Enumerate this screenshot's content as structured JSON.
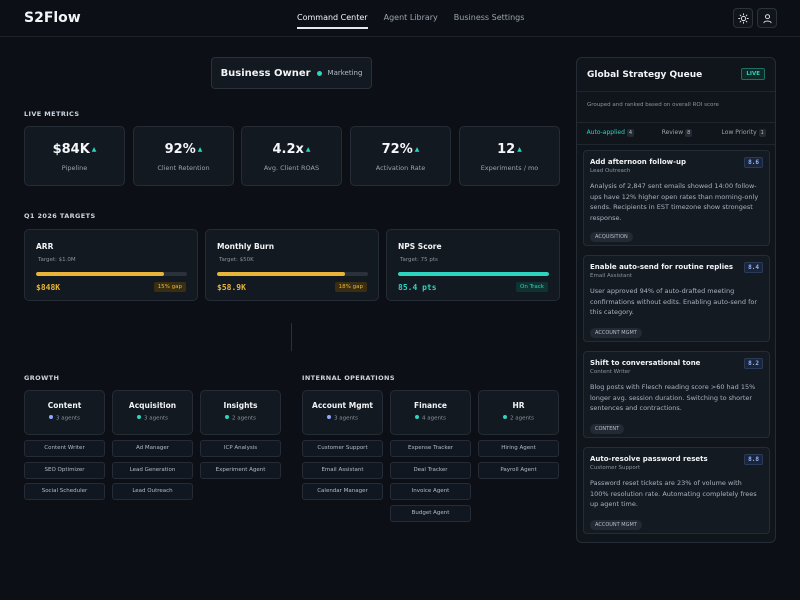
{
  "app": {
    "logo": "S2Flow"
  },
  "nav": {
    "items": [
      "Command Center",
      "Agent Library",
      "Business Settings"
    ]
  },
  "owner": {
    "title": "Business Owner",
    "subtitle": "Marketing"
  },
  "sections": {
    "live_metrics": "LIVE METRICS",
    "targets": "Q1 2026 TARGETS",
    "growth": "GROWTH",
    "internal_ops": "INTERNAL OPERATIONS"
  },
  "metrics": [
    {
      "value": "$84K",
      "label": "Pipeline"
    },
    {
      "value": "92%",
      "label": "Client Retention"
    },
    {
      "value": "4.2x",
      "label": "Avg. Client ROAS"
    },
    {
      "value": "72%",
      "label": "Activation Rate"
    },
    {
      "value": "12",
      "label": "Experiments / mo"
    }
  ],
  "metric_arrow": "▲",
  "targets": [
    {
      "title": "ARR",
      "target": "Target: $1.0M",
      "value": "$848K",
      "badge": "15% gap",
      "progress_pct": 85,
      "color": "#e8b53a"
    },
    {
      "title": "Monthly Burn",
      "target": "Target: $50K",
      "value": "$58.9K",
      "badge": "18% gap",
      "progress_pct": 85,
      "color": "#e8b53a"
    },
    {
      "title": "NPS Score",
      "target": "Target: 75 pts",
      "value": "85.4 pts",
      "badge": "On Track",
      "progress_pct": 100,
      "color": "#2dd4bf"
    }
  ],
  "departments": [
    {
      "name": "Content",
      "count": "3 agents",
      "dot": "#8fa8ff",
      "agents": [
        "Content Writer",
        "SEO Optimizer",
        "Social Scheduler"
      ]
    },
    {
      "name": "Acquisition",
      "count": "3 agents",
      "dot": "#2dd4bf",
      "agents": [
        "Ad Manager",
        "Lead Generation",
        "Lead Outreach"
      ]
    },
    {
      "name": "Insights",
      "count": "2 agents",
      "dot": "#2dd4bf",
      "agents": [
        "ICP Analysis",
        "Experiment Agent"
      ]
    },
    {
      "name": "Account Mgmt",
      "count": "3 agents",
      "dot": "#8fa8ff",
      "agents": [
        "Customer Support",
        "Email Assistant",
        "Calendar Manager"
      ]
    },
    {
      "name": "Finance",
      "count": "4 agents",
      "dot": "#2dd4bf",
      "agents": [
        "Expense Tracker",
        "Deal Tracker",
        "Invoice Agent",
        "Budget Agent"
      ]
    },
    {
      "name": "HR",
      "count": "2 agents",
      "dot": "#2dd4bf",
      "agents": [
        "Hiring Agent",
        "Payroll Agent"
      ]
    }
  ],
  "queue": {
    "title": "Global Strategy Queue",
    "live": "LIVE",
    "subtitle": "Grouped and ranked based on overall ROI score",
    "tabs": [
      {
        "label": "Auto-applied",
        "count": "4"
      },
      {
        "label": "Review",
        "count": "8"
      },
      {
        "label": "Low Priority",
        "count": "1"
      }
    ],
    "items": [
      {
        "title": "Add afternoon follow-up",
        "owner": "Lead Outreach",
        "score": "8.6",
        "body": "Analysis of 2,847 sent emails showed 14:00 follow-ups have 12% higher open rates than morning-only sends. Recipients in EST timezone show strongest response.",
        "tag": "ACQUISITION"
      },
      {
        "title": "Enable auto-send for routine replies",
        "owner": "Email Assistant",
        "score": "8.4",
        "body": "User approved 94% of auto-drafted meeting confirmations without edits. Enabling auto-send for this category.",
        "tag": "ACCOUNT MGMT"
      },
      {
        "title": "Shift to conversational tone",
        "owner": "Content Writer",
        "score": "8.2",
        "body": "Blog posts with Flesch reading score >60 had 15% longer avg. session duration. Switching to shorter sentences and contractions.",
        "tag": "CONTENT"
      },
      {
        "title": "Auto-resolve password resets",
        "owner": "Customer Support",
        "score": "8.8",
        "body": "Password reset tickets are 23% of volume with 100% resolution rate. Automating completely frees up agent time.",
        "tag": "ACCOUNT MGMT"
      }
    ]
  }
}
